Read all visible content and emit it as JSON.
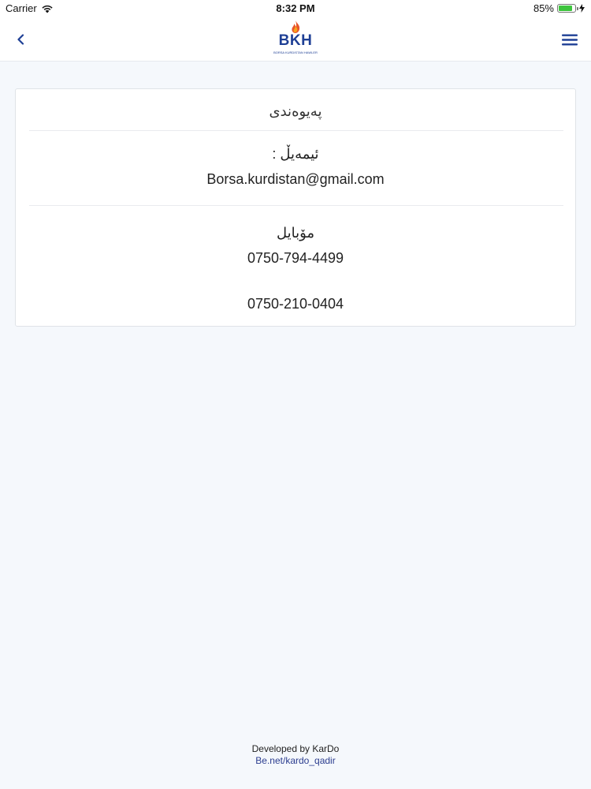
{
  "status_bar": {
    "carrier": "Carrier",
    "time": "8:32 PM",
    "battery": "85%",
    "battery_level": 0.85
  },
  "navbar": {
    "logo_text": "BKH",
    "logo_subtext": "BORSA KURDISTAN HAWLER",
    "accent_color": "#1e3f95"
  },
  "contact": {
    "title": "پەیوەندی",
    "email_label": "ئیمەیڵ :",
    "email_value": "Borsa.kurdistan@gmail.com",
    "mobile_label": "مۆبایل",
    "phone_1": "0750-794-4499",
    "phone_2": "0750-210-0404"
  },
  "footer": {
    "developer": "Developed by KarDo",
    "link": "Be.net/kardo_qadir"
  }
}
